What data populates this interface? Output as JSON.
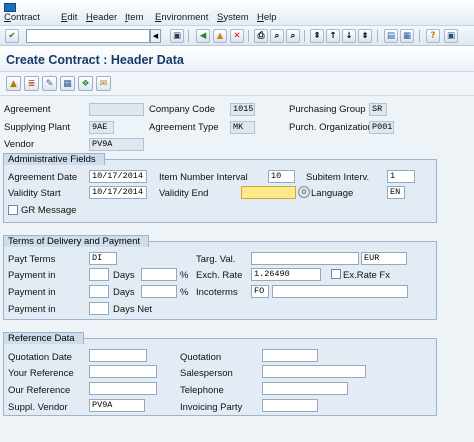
{
  "menu": {
    "contract": "Contract",
    "edit": "Edit",
    "header": "Header",
    "item": "Item",
    "environment": "Environment",
    "system": "System",
    "help": "Help"
  },
  "toolbar": {
    "command_value": ""
  },
  "title": "Create Contract : Header Data",
  "header": {
    "agreement_label": "Agreement",
    "agreement_value": "",
    "company_code_label": "Company Code",
    "company_code_value": "1015",
    "purchasing_group_label": "Purchasing Group",
    "purchasing_group_value": "SR",
    "supplying_plant_label": "Supplying Plant",
    "supplying_plant_value": "9AE",
    "agreement_type_label": "Agreement Type",
    "agreement_type_value": "MK",
    "purch_org_label": "Purch. Organization",
    "purch_org_value": "P001",
    "vendor_label": "Vendor",
    "vendor_value": "PV9A"
  },
  "admin": {
    "title": "Administrative Fields",
    "agreement_date_label": "Agreement Date",
    "agreement_date_value": "10/17/2014",
    "item_interval_label": "Item Number Interval",
    "item_interval_value": "10",
    "subitem_interval_label": "Subitem Interv.",
    "subitem_interval_value": "1",
    "validity_start_label": "Validity Start",
    "validity_start_value": "10/17/2014",
    "validity_end_label": "Validity End",
    "validity_end_value": "",
    "language_label": "Language",
    "language_value": "EN",
    "gr_message_label": "GR Message"
  },
  "delivery": {
    "title": "Terms of Delivery and Payment",
    "payt_terms_label": "Payt Terms",
    "payt_terms_value": "DI",
    "targ_val_label": "Targ. Val.",
    "targ_val_value": "",
    "currency_value": "EUR",
    "payment_in_label": "Payment in",
    "days_label": "Days",
    "days_net_label": "Days Net",
    "percent": "%",
    "exch_rate_label": "Exch. Rate",
    "exch_rate_value": "1.26490",
    "ex_rate_fx_label": "Ex.Rate Fx",
    "incoterms_label": "Incoterms",
    "incoterms_value": "FO"
  },
  "reference": {
    "title": "Reference Data",
    "quotation_date_label": "Quotation Date",
    "quotation_label": "Quotation",
    "your_reference_label": "Your Reference",
    "salesperson_label": "Salesperson",
    "our_reference_label": "Our Reference",
    "telephone_label": "Telephone",
    "suppl_vendor_label": "Suppl. Vendor",
    "suppl_vendor_value": "PV9A",
    "invoicing_party_label": "Invoicing Party"
  }
}
